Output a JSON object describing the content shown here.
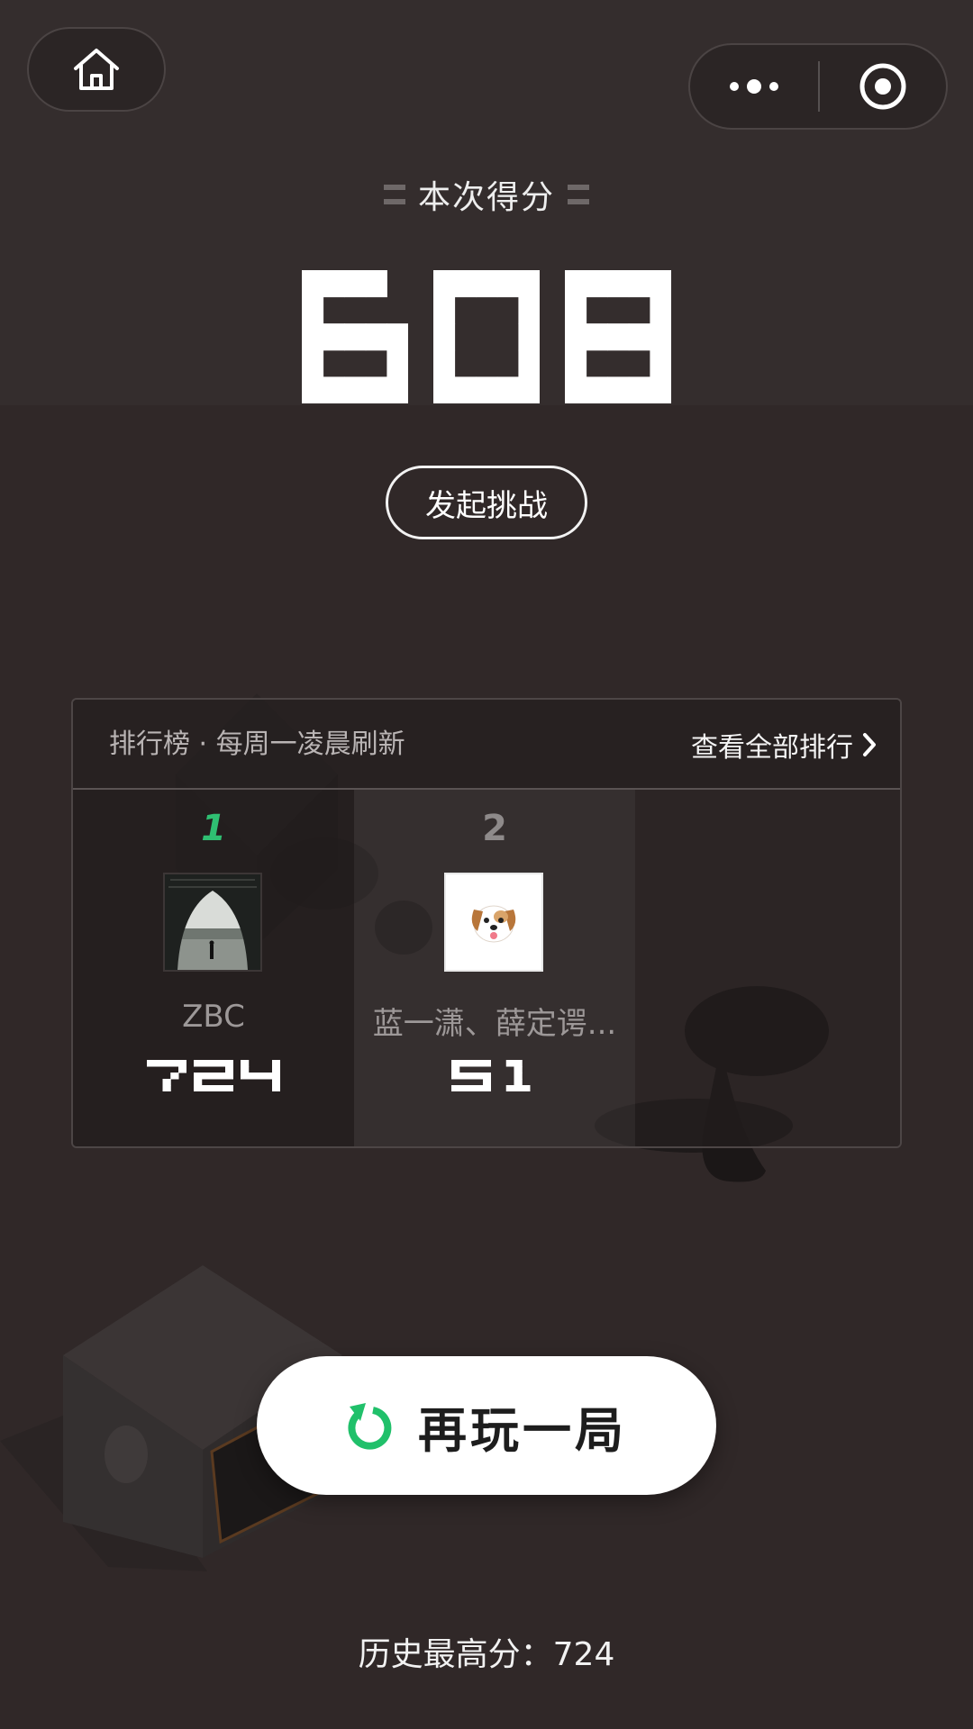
{
  "top_bar": {
    "home_icon": "home-icon",
    "more_icon": "more-dots-icon",
    "close_icon": "record-close-icon"
  },
  "score": {
    "title": "本次得分",
    "value": "608"
  },
  "challenge_button": "发起挑战",
  "leaderboard": {
    "title": "排行榜 · 每周一凌晨刷新",
    "view_all": "查看全部排行",
    "entries": [
      {
        "rank": "1",
        "name": "ZBC",
        "score": "724",
        "avatar": "eiffel-tower-photo"
      },
      {
        "rank": "2",
        "name": "蓝一潇、薛定谔...",
        "score": "51",
        "avatar": "dog-emoji"
      }
    ]
  },
  "play_again": {
    "label": "再玩一局",
    "icon": "restart-icon"
  },
  "best_score": {
    "label": "历史最高分：",
    "value": "724"
  },
  "colors": {
    "background": "#302828",
    "accent_green": "#2fbf72",
    "text_light": "#f2f2f2"
  }
}
